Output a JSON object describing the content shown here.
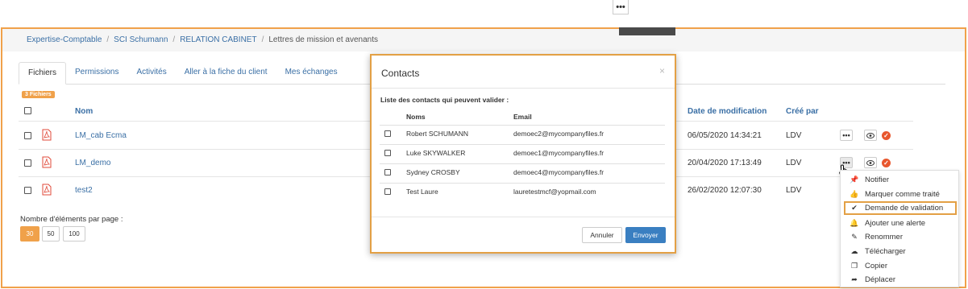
{
  "top_menu": {
    "dots": "•••"
  },
  "breadcrumb": {
    "items": [
      "Expertise-Comptable",
      "SCI Schumann",
      "RELATION CABINET"
    ],
    "current": "Lettres de mission et avenants",
    "separator": "/"
  },
  "tabs": [
    "Fichiers",
    "Permissions",
    "Activités",
    "Aller à la fiche du client",
    "Mes échanges"
  ],
  "files_badge": "3 Fichiers",
  "table": {
    "headers": {
      "name": "Nom",
      "date": "Date de modification",
      "creator": "Créé par"
    },
    "rows": [
      {
        "name": "LM_cab Ecma",
        "date": "06/05/2020 14:34:21",
        "creator": "LDV"
      },
      {
        "name": "LM_demo",
        "date": "20/04/2020 17:13:49",
        "creator": "LDV"
      },
      {
        "name": "test2",
        "date": "26/02/2020 12:07:30",
        "creator": "LDV"
      }
    ]
  },
  "pagination": {
    "label": "Nombre d'éléments par page :",
    "options": [
      "30",
      "50",
      "100"
    ]
  },
  "modal": {
    "title": "Contacts",
    "close": "×",
    "subtitle": "Liste des contacts qui peuvent valider :",
    "col_names": "Noms",
    "col_email": "Email",
    "contacts": [
      {
        "name": "Robert SCHUMANN",
        "email": "demoec2@mycompanyfiles.fr"
      },
      {
        "name": "Luke SKYWALKER",
        "email": "demoec1@mycompanyfiles.fr"
      },
      {
        "name": "Sydney CROSBY",
        "email": "demoec4@mycompanyfiles.fr"
      },
      {
        "name": "Test Laure",
        "email": "lauretestmcf@yopmail.com"
      }
    ],
    "cancel": "Annuler",
    "send": "Envoyer"
  },
  "action_menu": {
    "items": [
      {
        "label": "Notifier",
        "icon": "pin-icon"
      },
      {
        "label": "Marquer comme traité",
        "icon": "thumbs-up-icon"
      },
      {
        "label": "Demande de validation",
        "icon": "check-circle-icon"
      },
      {
        "label": "Ajouter une alerte",
        "icon": "bell-icon"
      },
      {
        "label": "Renommer",
        "icon": "pencil-icon"
      },
      {
        "label": "Télécharger",
        "icon": "cloud-download-icon"
      },
      {
        "label": "Copier",
        "icon": "copy-icon"
      },
      {
        "label": "Déplacer",
        "icon": "arrow-icon"
      }
    ]
  },
  "colors": {
    "accent": "#f0a14a",
    "link": "#3a6fa5",
    "primary_button": "#3a7fc1",
    "validate": "#e8572e"
  }
}
